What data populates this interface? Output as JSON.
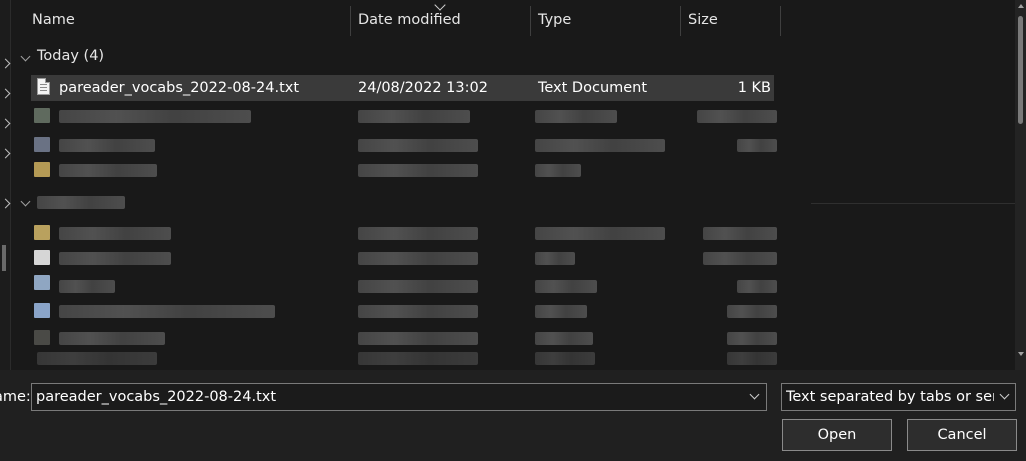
{
  "columns": {
    "name": "Name",
    "date_modified": "Date modified",
    "type": "Type",
    "size": "Size"
  },
  "groups": [
    {
      "label": "Today (4)"
    }
  ],
  "files": [
    {
      "name": "pareader_vocabs_2022-08-24.txt",
      "date_modified": "24/08/2022 13:02",
      "type": "Text Document",
      "size": "1 KB",
      "icon": "text-file-icon",
      "selected": true
    }
  ],
  "bottom": {
    "file_name_label": "ame:",
    "file_name_value": "pareader_vocabs_2022-08-24.txt",
    "file_type_value": "Text separated by tabs or semic",
    "open_label": "Open",
    "cancel_label": "Cancel"
  },
  "colors": {
    "background": "#191919",
    "selected_row": "#3a3a3a",
    "bottom_panel": "#202020",
    "button": "#2d2d2d"
  }
}
